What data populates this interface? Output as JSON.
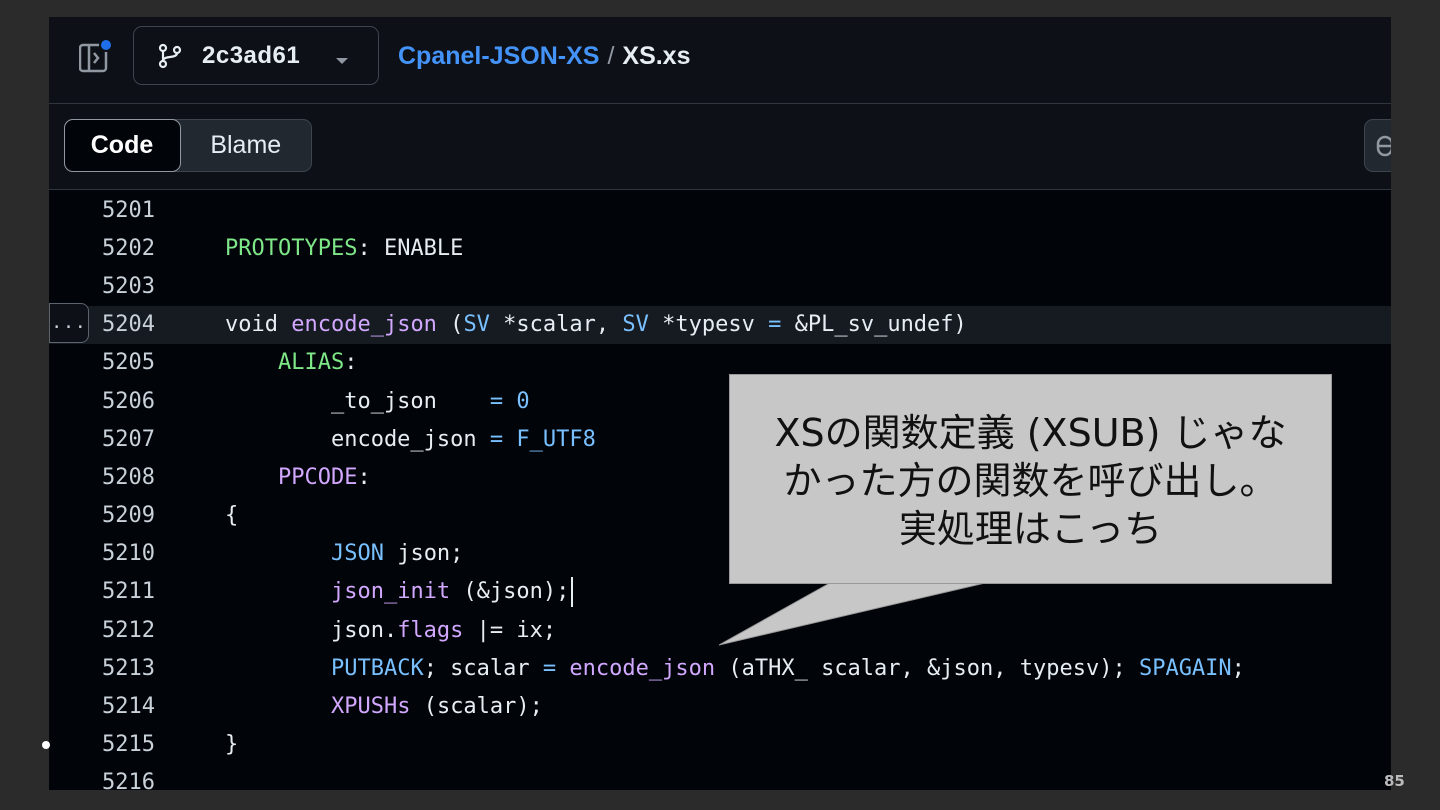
{
  "header": {
    "branch": "2c3ad61",
    "repo": "Cpanel-JSON-XS",
    "separator": "/",
    "file": "XS.xs"
  },
  "view_tabs": {
    "code": "Code",
    "blame": "Blame"
  },
  "code_lines": [
    {
      "n": "5201",
      "tokens": []
    },
    {
      "n": "5202",
      "tokens": [
        {
          "t": "PROTOTYPES",
          "c": "green"
        },
        {
          "t": ": ENABLE",
          "c": "plain"
        }
      ]
    },
    {
      "n": "5203",
      "tokens": []
    },
    {
      "n": "5204",
      "tokens": [
        {
          "t": "void ",
          "c": "plain"
        },
        {
          "t": "encode_json",
          "c": "purple"
        },
        {
          "t": " (",
          "c": "plain"
        },
        {
          "t": "SV",
          "c": "blue"
        },
        {
          "t": " *scalar, ",
          "c": "plain"
        },
        {
          "t": "SV",
          "c": "blue"
        },
        {
          "t": " *typesv ",
          "c": "plain"
        },
        {
          "t": "=",
          "c": "blue"
        },
        {
          "t": " &PL_sv_undef)",
          "c": "plain"
        }
      ]
    },
    {
      "n": "5205",
      "tokens": [
        {
          "t": "    ",
          "c": "plain"
        },
        {
          "t": "ALIAS",
          "c": "green"
        },
        {
          "t": ":",
          "c": "plain"
        }
      ]
    },
    {
      "n": "5206",
      "tokens": [
        {
          "t": "        _to_json    ",
          "c": "plain"
        },
        {
          "t": "= 0",
          "c": "blue"
        }
      ]
    },
    {
      "n": "5207",
      "tokens": [
        {
          "t": "        encode_json ",
          "c": "plain"
        },
        {
          "t": "= F_UTF8",
          "c": "blue"
        }
      ]
    },
    {
      "n": "5208",
      "tokens": [
        {
          "t": "    ",
          "c": "plain"
        },
        {
          "t": "PPCODE",
          "c": "purple"
        },
        {
          "t": ":",
          "c": "plain"
        }
      ]
    },
    {
      "n": "5209",
      "tokens": [
        {
          "t": "{",
          "c": "plain"
        }
      ]
    },
    {
      "n": "5210",
      "tokens": [
        {
          "t": "        ",
          "c": "plain"
        },
        {
          "t": "JSON",
          "c": "blue"
        },
        {
          "t": " json;",
          "c": "plain"
        }
      ]
    },
    {
      "n": "5211",
      "tokens": [
        {
          "t": "        ",
          "c": "plain"
        },
        {
          "t": "json_init",
          "c": "purple"
        },
        {
          "t": " (&json);",
          "c": "plain"
        }
      ],
      "caret": true
    },
    {
      "n": "5212",
      "tokens": [
        {
          "t": "        json.",
          "c": "plain"
        },
        {
          "t": "flags",
          "c": "purple"
        },
        {
          "t": " |= ix;",
          "c": "plain"
        }
      ]
    },
    {
      "n": "5213",
      "tokens": [
        {
          "t": "        ",
          "c": "plain"
        },
        {
          "t": "PUTBACK",
          "c": "blue"
        },
        {
          "t": "; scalar ",
          "c": "plain"
        },
        {
          "t": "=",
          "c": "blue"
        },
        {
          "t": " ",
          "c": "plain"
        },
        {
          "t": "encode_json",
          "c": "purple"
        },
        {
          "t": " (aTHX_ scalar, &json, typesv); ",
          "c": "plain"
        },
        {
          "t": "SPAGAIN",
          "c": "blue"
        },
        {
          "t": ";",
          "c": "plain"
        }
      ]
    },
    {
      "n": "5214",
      "tokens": [
        {
          "t": "        ",
          "c": "plain"
        },
        {
          "t": "XPUSHs",
          "c": "purple"
        },
        {
          "t": " (scalar);",
          "c": "plain"
        }
      ]
    },
    {
      "n": "5215",
      "tokens": [
        {
          "t": "}",
          "c": "plain"
        }
      ]
    },
    {
      "n": "5216",
      "tokens": []
    }
  ],
  "expand_lines_button": "...",
  "callout": {
    "lines": [
      "XSの関数定義 (XSUB) じゃな",
      "かった方の関数を呼び出し。",
      "実処理はこっち"
    ]
  },
  "slide": {
    "page_number": "85"
  },
  "colors": {
    "green": "#7ee787",
    "purple": "#d2a8ff",
    "blue": "#79c0ff",
    "plain": "#e6edf3",
    "link": "#4493f8"
  }
}
